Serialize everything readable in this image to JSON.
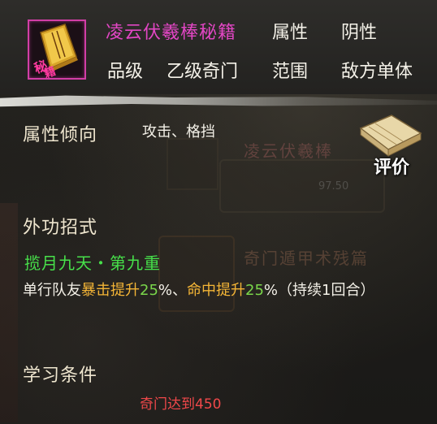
{
  "item": {
    "name": "凌云伏羲棒秘籍",
    "attr_label": "属性",
    "attr_value": "阴性",
    "grade_label": "品级",
    "grade_value": "乙级奇门",
    "range_label": "范围",
    "range_value": "敌方单体",
    "icon": "secret-manual-book-icon",
    "icon_frame_color": "#d23ea6"
  },
  "tendency": {
    "title": "属性倾向",
    "value": "攻击、格挡"
  },
  "review_button": {
    "label": "评价",
    "icon": "scroll-book-icon"
  },
  "skill": {
    "title": "外功招式",
    "name": "揽月九天・第九重",
    "desc": {
      "p1": "单行队友",
      "crit": "暴击提升",
      "crit_val": "25",
      "p2": "%、",
      "hit": "命中提升",
      "hit_val": "25",
      "p3": "%（持续1回合）"
    }
  },
  "learn": {
    "title": "学习条件",
    "requirement": "奇门达到450"
  },
  "colors": {
    "item_name": "#e246c4",
    "skill_name": "#47e04a",
    "highlight_gold": "#f4b536",
    "highlight_number": "#7ad64a",
    "requirement": "#f0484a"
  },
  "background_ghost": {
    "title1": "凌云伏羲棒",
    "number": "97.50",
    "title2": "奇门遁甲术残篇"
  }
}
